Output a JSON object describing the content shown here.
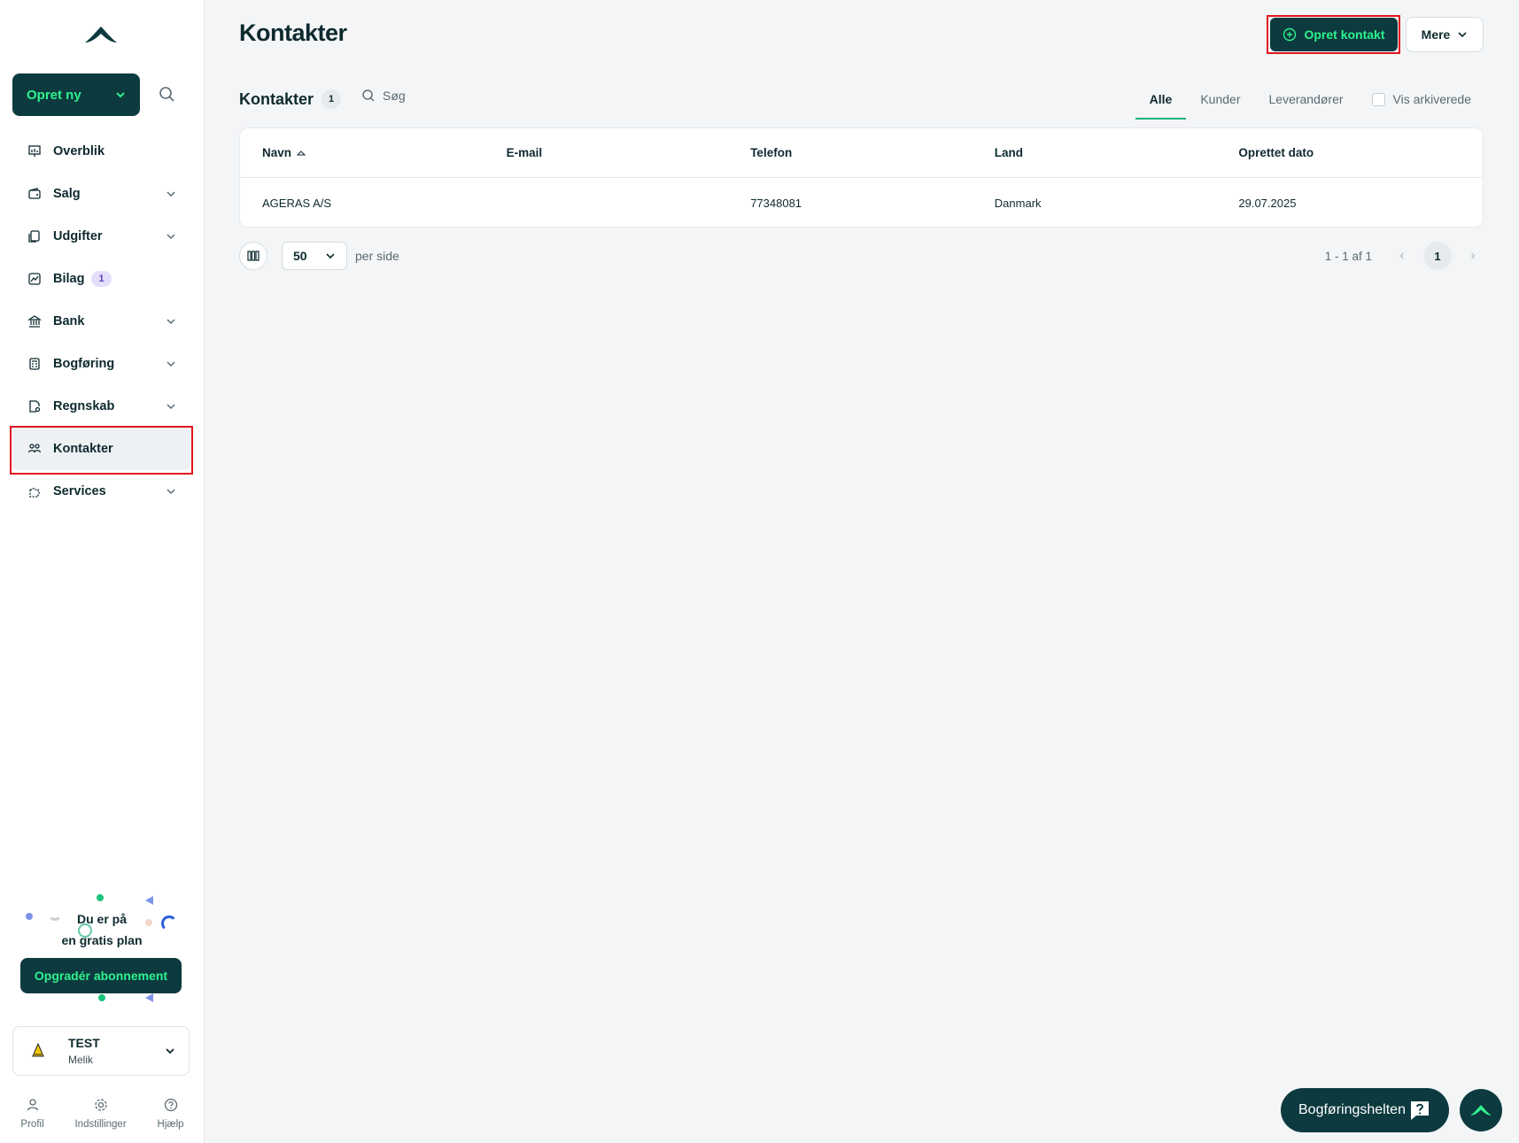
{
  "sidebar": {
    "create_label": "Opret ny",
    "items": [
      {
        "label": "Overblik"
      },
      {
        "label": "Salg"
      },
      {
        "label": "Udgifter"
      },
      {
        "label": "Bilag",
        "badge": "1"
      },
      {
        "label": "Bank"
      },
      {
        "label": "Bogføring"
      },
      {
        "label": "Regnskab"
      },
      {
        "label": "Kontakter"
      },
      {
        "label": "Services"
      }
    ],
    "plan": {
      "line1": "Du er på",
      "line2": "en gratis plan",
      "upgrade_label": "Opgradér abonnement"
    },
    "account": {
      "name": "TEST",
      "sub": "Melik"
    },
    "bottom": [
      {
        "label": "Profil"
      },
      {
        "label": "Indstillinger"
      },
      {
        "label": "Hjælp"
      }
    ]
  },
  "header": {
    "title": "Kontakter",
    "primary_label": "Opret kontakt",
    "more_label": "Mere"
  },
  "toolbar": {
    "title": "Kontakter",
    "count": "1",
    "search_placeholder": "Søg",
    "filters": [
      {
        "label": "Alle",
        "active": true
      },
      {
        "label": "Kunder"
      },
      {
        "label": "Leverandører"
      }
    ],
    "archived_label": "Vis arkiverede"
  },
  "table": {
    "columns": [
      "Navn",
      "E-mail",
      "Telefon",
      "Land",
      "Oprettet dato"
    ],
    "rows": [
      [
        "AGERAS A/S",
        "",
        "77348081",
        "Danmark",
        "29.07.2025"
      ]
    ]
  },
  "pagination": {
    "page_size": "50",
    "per_side": "per side",
    "range": "1 - 1 af 1",
    "current_page": "1"
  },
  "helper": {
    "label": "Bogføringshelten"
  },
  "colors": {
    "brand_dark": "#0c3a3f",
    "brand_green": "#2ff28d",
    "highlight": "#e0141e"
  }
}
